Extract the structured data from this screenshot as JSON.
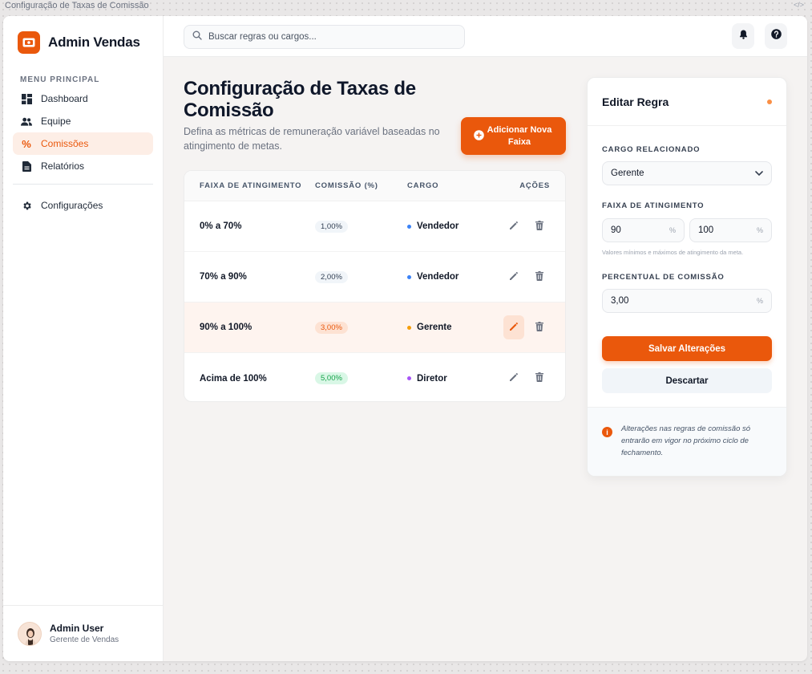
{
  "window": {
    "title": "Configuração de Taxas de Comissão",
    "code_icon": "</>"
  },
  "brand": {
    "name": "Admin Vendas",
    "logo_icon": "wallet-icon",
    "color": "#ea580c"
  },
  "sidebar": {
    "heading": "MENU PRINCIPAL",
    "items": [
      {
        "label": "Dashboard",
        "icon": "dashboard-icon"
      },
      {
        "label": "Equipe",
        "icon": "users-icon"
      },
      {
        "label": "Comissões",
        "icon": "percent-icon",
        "active": true
      },
      {
        "label": "Relatórios",
        "icon": "document-icon"
      }
    ],
    "settings": {
      "label": "Configurações",
      "icon": "gear-icon"
    }
  },
  "user": {
    "name": "Admin User",
    "role": "Gerente de Vendas"
  },
  "search": {
    "placeholder": "Buscar regras ou cargos..."
  },
  "page": {
    "title": "Configuração de Taxas de Comissão",
    "subtitle": "Defina as métricas de remuneração variável baseadas no atingimento de metas.",
    "add_button": "Adicionar Nova Faixa"
  },
  "table": {
    "headers": [
      "FAIXA DE ATINGIMENTO",
      "COMISSÃO (%)",
      "CARGO",
      "AÇÕES"
    ],
    "rows": [
      {
        "range": "0% a 70%",
        "commission": "1,00%",
        "role": "Vendedor",
        "role_color": "#3b82f6",
        "badge": "gray"
      },
      {
        "range": "70% a 90%",
        "commission": "2,00%",
        "role": "Vendedor",
        "role_color": "#3b82f6",
        "badge": "gray"
      },
      {
        "range": "90% a 100%",
        "commission": "3,00%",
        "role": "Gerente",
        "role_color": "#f59e0b",
        "badge": "orange",
        "selected": true
      },
      {
        "range": "Acima de 100%",
        "commission": "5,00%",
        "role": "Diretor",
        "role_color": "#a855f7",
        "badge": "green"
      }
    ]
  },
  "editor": {
    "title": "Editar Regra",
    "role_label": "CARGO RELACIONADO",
    "role_value": "Gerente",
    "range_label": "FAIXA DE ATINGIMENTO",
    "range_min": "90",
    "range_max": "100",
    "unit": "%",
    "range_hint": "Valores mínimos e máximos de atingimento da meta.",
    "commission_label": "PERCENTUAL DE COMISSÃO",
    "commission_value": "3,00",
    "save_button": "Salvar Alterações",
    "discard_button": "Descartar",
    "info_icon": "i",
    "info": "Alterações nas regras de comissão só entrarão em vigor no próximo ciclo de fechamento."
  }
}
